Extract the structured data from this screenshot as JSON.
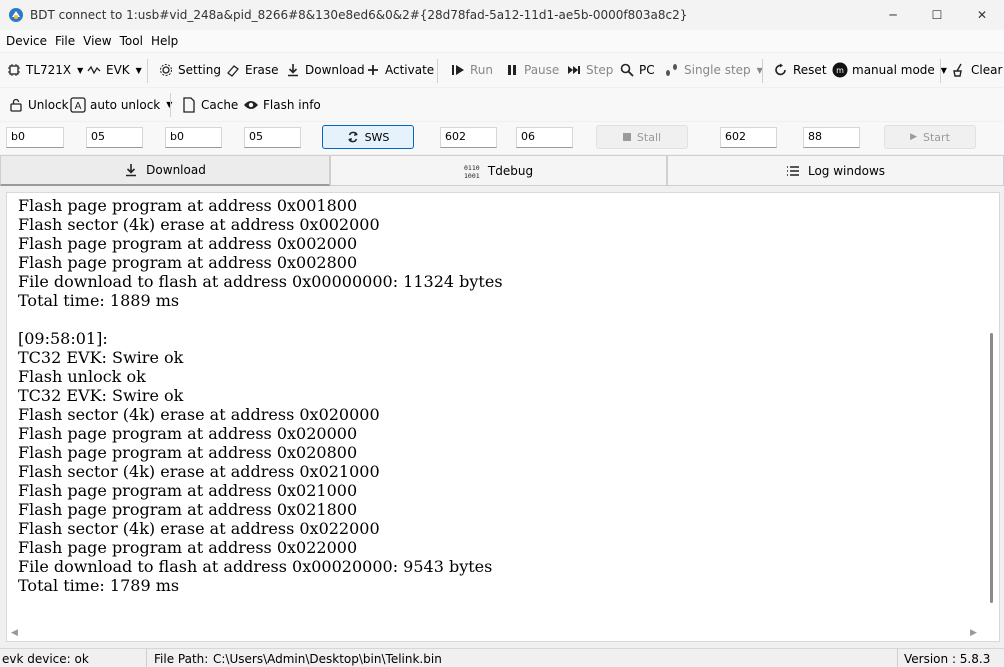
{
  "window": {
    "title": "BDT connect to 1:usb#vid_248a&pid_8266#8&130e8ed6&0&2#{28d78fad-5a12-11d1-ae5b-0000f803a8c2}",
    "minimize": "─",
    "maximize": "☐",
    "close": "✕"
  },
  "menu": [
    "Device",
    "File",
    "View",
    "Tool",
    "Help"
  ],
  "toolbar1": {
    "chip": "TL721X",
    "evk": "EVK",
    "setting": "Setting",
    "erase": "Erase",
    "download": "Download",
    "activate": "Activate",
    "run": "Run",
    "pause": "Pause",
    "step": "Step",
    "pc": "PC",
    "single_step": "Single step",
    "reset": "Reset",
    "mode": "manual mode",
    "clear": "Clear"
  },
  "toolbar2": {
    "unlock": "Unlock",
    "auto_unlock": "auto unlock",
    "cache": "Cache",
    "flash_info": "Flash info"
  },
  "params": {
    "f1": "b0",
    "f2": "05",
    "f3": "b0",
    "f4": "05",
    "sws": "SWS",
    "f5": "602",
    "f6": "06",
    "stall": "Stall",
    "f7": "602",
    "f8": "88",
    "start": "Start"
  },
  "tabs": {
    "download": "Download",
    "tdebug": "Tdebug",
    "log": "Log windows"
  },
  "log_lines": [
    "Flash page program at address 0x001800",
    "Flash sector (4k) erase at address 0x002000",
    "Flash page program at address 0x002000",
    "Flash page program at address 0x002800",
    "File download to flash at address 0x00000000: 11324 bytes",
    "Total time: 1889 ms",
    "",
    "[09:58:01]:",
    "TC32 EVK: Swire ok",
    "Flash unlock ok",
    "TC32 EVK: Swire ok",
    "Flash sector (4k) erase at address 0x020000",
    "Flash page program at address 0x020000",
    "Flash page program at address 0x020800",
    "Flash sector (4k) erase at address 0x021000",
    "Flash page program at address 0x021000",
    "Flash page program at address 0x021800",
    "Flash sector (4k) erase at address 0x022000",
    "Flash page program at address 0x022000",
    "File download to flash at address 0x00020000: 9543 bytes",
    "Total time: 1789 ms"
  ],
  "status": {
    "device": "evk device: ok",
    "file_path_label": "File Path:",
    "file_path": "C:\\Users\\Admin\\Desktop\\bin\\Telink.bin",
    "version": "Version : 5.8.3"
  },
  "colors": {
    "accent": "#0067c0",
    "log_bg": "#ffffff"
  }
}
